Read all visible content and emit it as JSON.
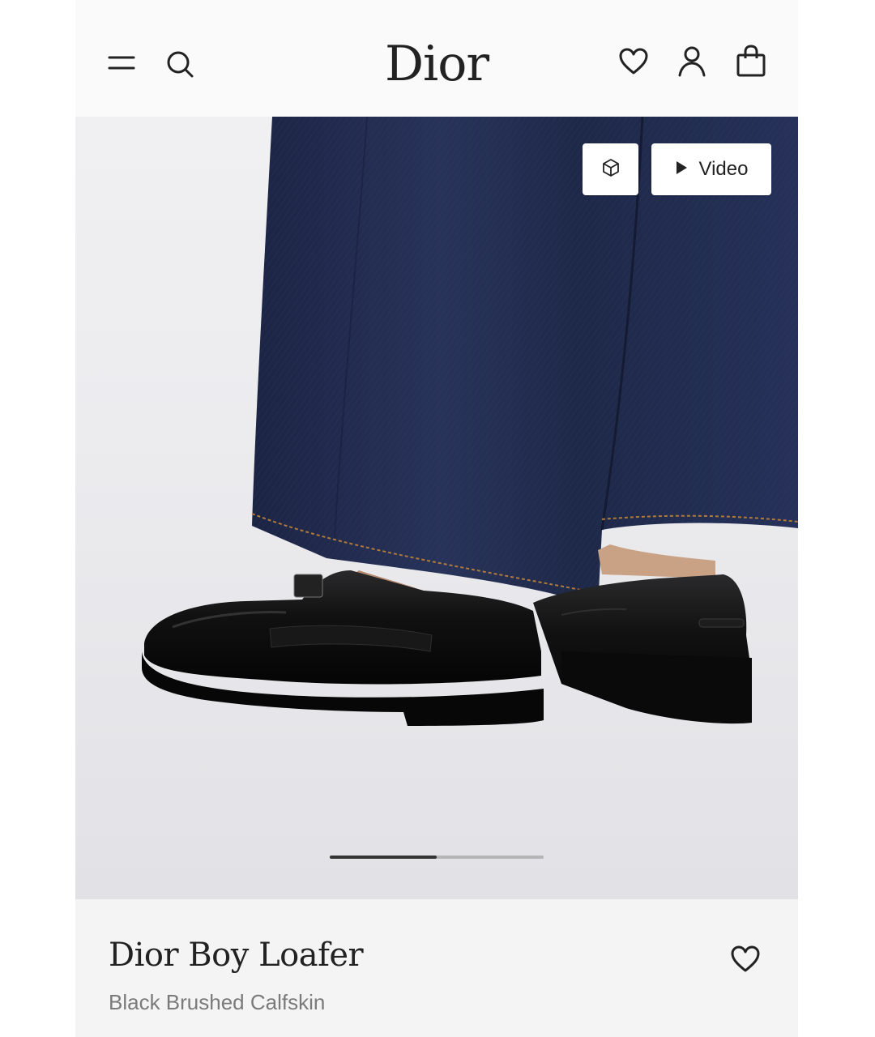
{
  "header": {
    "logo_text": "Dior",
    "icons": [
      "menu-icon",
      "search-icon",
      "heart-icon",
      "account-icon",
      "shopping-bag-icon"
    ]
  },
  "media": {
    "video_label": "Video",
    "view_3d_icon": "cube-icon",
    "carousel_progress": 0.5
  },
  "product": {
    "name": "Dior Boy Loafer",
    "subtitle": "Black Brushed Calfskin"
  },
  "colors": {
    "text_primary": "#222222",
    "text_secondary": "#7a7a7a",
    "denim": "#1f2a4a",
    "leather": "#121212",
    "background": "#fafafa"
  }
}
